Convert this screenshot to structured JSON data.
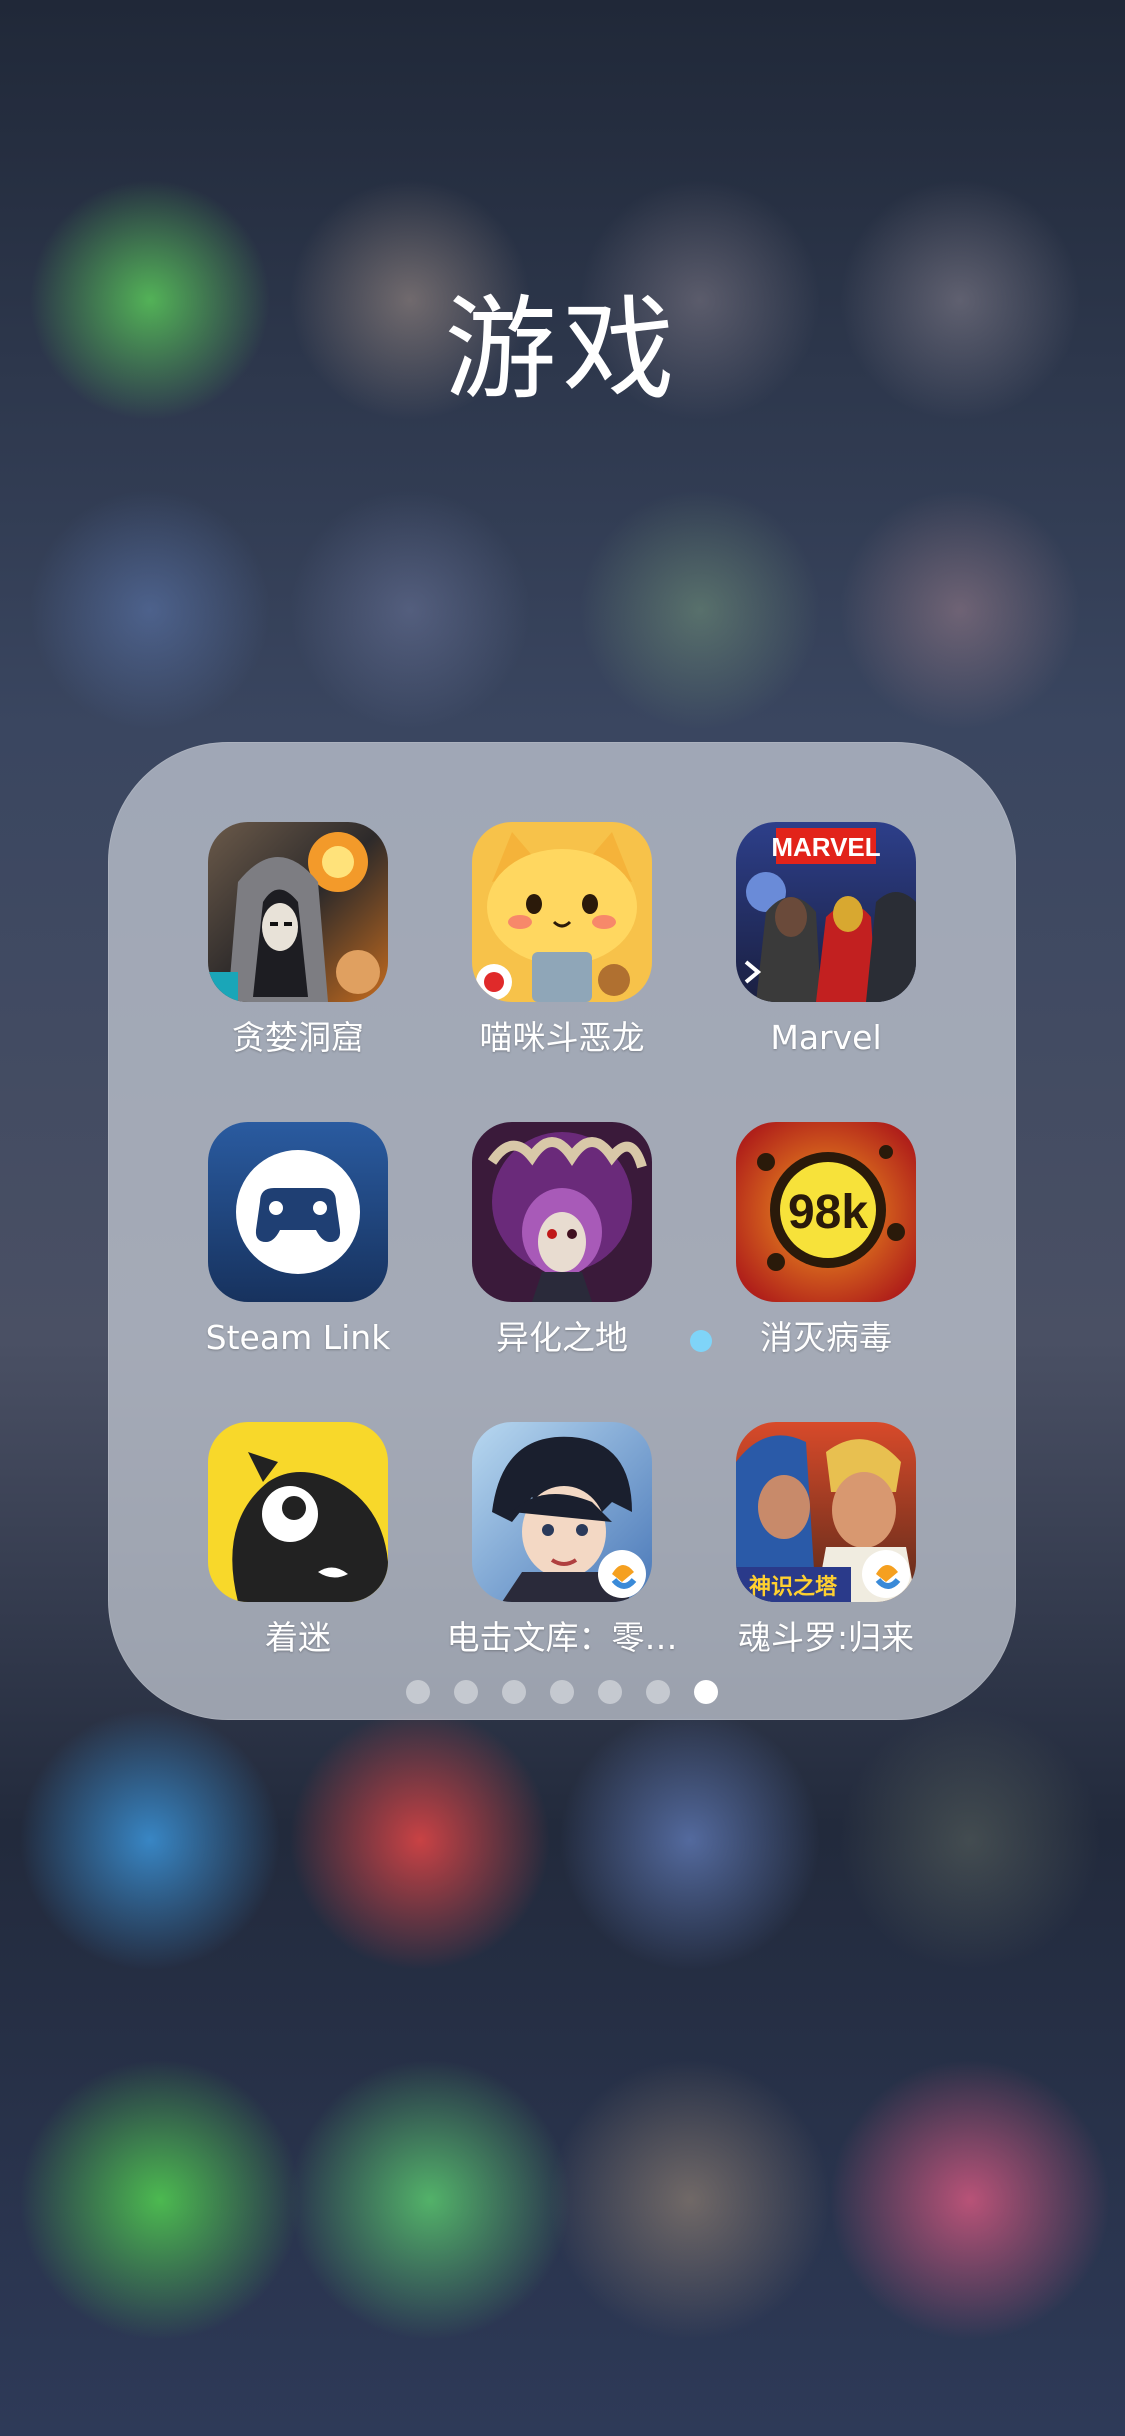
{
  "folder": {
    "title": "游戏",
    "apps": [
      {
        "label": "贪婪洞窟",
        "icon": "hooded-wizard-icon"
      },
      {
        "label": "喵咪斗恶龙",
        "icon": "yellow-cat-knight-icon"
      },
      {
        "label": "Marvel",
        "icon": "marvel-heroes-icon",
        "badge_text": "MARVEL"
      },
      {
        "label": "Steam Link",
        "icon": "gamepad-icon"
      },
      {
        "label": "异化之地",
        "icon": "purple-monster-icon"
      },
      {
        "label": "消灭病毒",
        "icon": "virus-98k-icon",
        "badge_text": "98k",
        "new_dot": true
      },
      {
        "label": "着迷",
        "icon": "black-bird-icon"
      },
      {
        "label": "电击文库：零…",
        "icon": "anime-swordsman-icon"
      },
      {
        "label": "魂斗罗:归来",
        "icon": "contra-soldiers-icon",
        "badge_text": "神识之塔"
      }
    ],
    "page_count": 7,
    "current_page": 7
  },
  "colors": {
    "folder_bg": "#c8cdd7",
    "new_dot": "#7fd4f8",
    "steam_blue": "#1f4a8a"
  }
}
